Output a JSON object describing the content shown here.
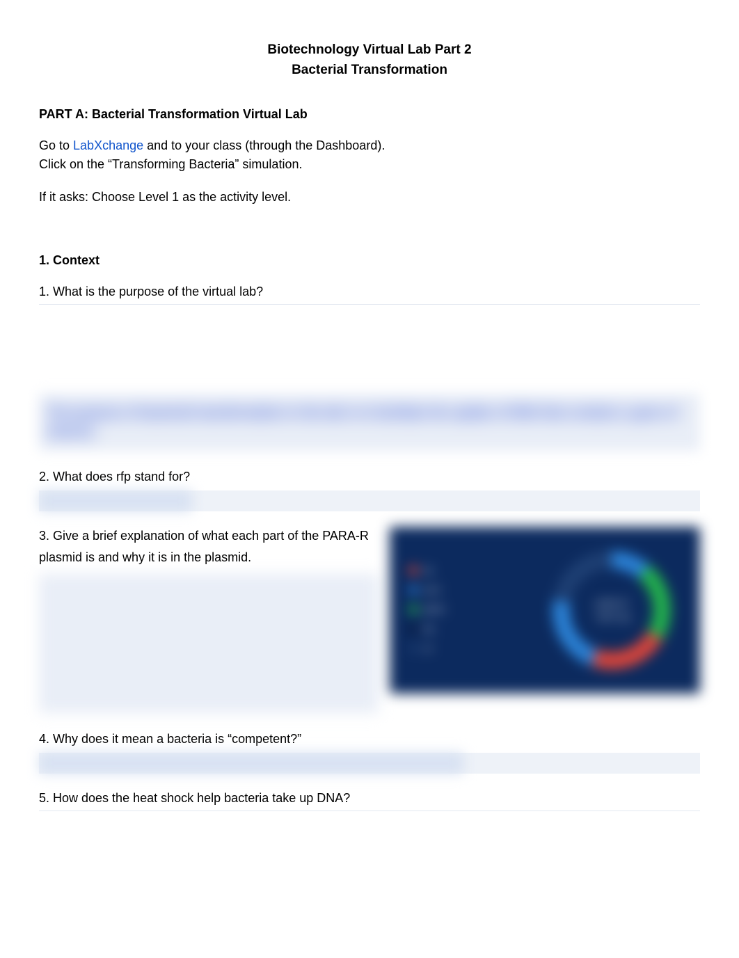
{
  "header": {
    "title1": "Biotechnology Virtual Lab Part 2",
    "title2": "Bacterial Transformation"
  },
  "partA": {
    "heading": "PART A: Bacterial Transformation Virtual Lab",
    "intro_prefix": "Go to ",
    "intro_link": "LabXchange",
    "intro_suffix": " and to your class (through the Dashboard).",
    "intro_line2": "Click on the “Transforming Bacteria” simulation.",
    "intro_line3": "If it asks: Choose Level 1 as the activity level."
  },
  "context": {
    "heading": "1. Context",
    "q1": "1. What is the purpose of the virtual lab?",
    "q1_answer_blur": "The purpose of bacterial transformation in the lab is to facilitate the uptake of DNA that contains a gene of interest.",
    "q2": "2. What does rfp stand for?",
    "q3_line1": "3. Give a brief explanation of what each part of the PARA-R",
    "q3_line2": "plasmid is and why it is in the plasmid.",
    "q4": "4. Why does it mean a bacteria is “competent?”",
    "q5": "5. How does the heat shock help bacteria take up DNA?"
  },
  "plasmid": {
    "center_line1": "pARA-R",
    "center_line2": "~4872 bp",
    "legend": [
      {
        "color": "#d9443a",
        "label": "rfp"
      },
      {
        "color": "#2b82d6",
        "label": "araC"
      },
      {
        "color": "#22b14c",
        "label": "pBAD"
      },
      {
        "color": "#0a1b3d",
        "label": "bla"
      },
      {
        "color": "#1e3f73",
        "label": "ori"
      }
    ]
  }
}
